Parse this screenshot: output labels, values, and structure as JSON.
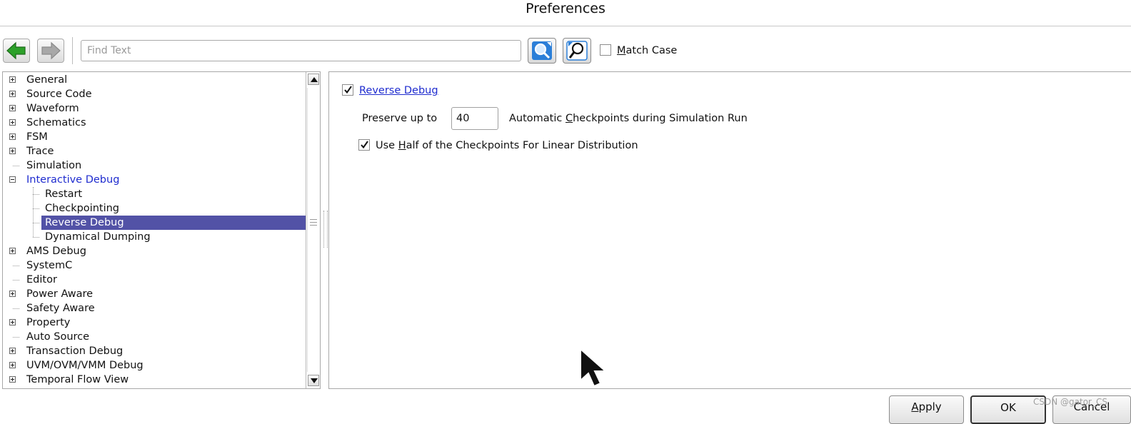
{
  "window": {
    "title": "Preferences"
  },
  "toolbar": {
    "back_icon": "back-arrow-icon",
    "forward_icon": "forward-arrow-icon",
    "find_placeholder": "Find Text",
    "find_value": "",
    "find_next_icon": "find-next-icon",
    "find_prev_icon": "find-previous-icon",
    "match_case_label_pre": "",
    "match_case_accel": "M",
    "match_case_label_post": "atch Case",
    "match_case_checked": false
  },
  "tree": {
    "items": [
      {
        "label": "General",
        "level": 0,
        "expander": "plus"
      },
      {
        "label": "Source Code",
        "level": 0,
        "expander": "plus"
      },
      {
        "label": "Waveform",
        "level": 0,
        "expander": "plus"
      },
      {
        "label": "Schematics",
        "level": 0,
        "expander": "plus"
      },
      {
        "label": "FSM",
        "level": 0,
        "expander": "plus"
      },
      {
        "label": "Trace",
        "level": 0,
        "expander": "plus"
      },
      {
        "label": "Simulation",
        "level": 0,
        "expander": "none"
      },
      {
        "label": "Interactive Debug",
        "level": 0,
        "expander": "minus",
        "state": "active"
      },
      {
        "label": "Restart",
        "level": 1,
        "expander": "none"
      },
      {
        "label": "Checkpointing",
        "level": 1,
        "expander": "none"
      },
      {
        "label": "Reverse Debug",
        "level": 1,
        "expander": "none",
        "state": "selected"
      },
      {
        "label": "Dynamical Dumping",
        "level": 1,
        "expander": "none"
      },
      {
        "label": "AMS Debug",
        "level": 0,
        "expander": "plus"
      },
      {
        "label": "SystemC",
        "level": 0,
        "expander": "none"
      },
      {
        "label": "Editor",
        "level": 0,
        "expander": "none"
      },
      {
        "label": "Power Aware",
        "level": 0,
        "expander": "plus"
      },
      {
        "label": "Safety Aware",
        "level": 0,
        "expander": "none"
      },
      {
        "label": "Property",
        "level": 0,
        "expander": "plus"
      },
      {
        "label": "Auto Source",
        "level": 0,
        "expander": "none"
      },
      {
        "label": "Transaction Debug",
        "level": 0,
        "expander": "plus"
      },
      {
        "label": "UVM/OVM/VMM Debug",
        "level": 0,
        "expander": "plus"
      },
      {
        "label": "Temporal Flow View",
        "level": 0,
        "expander": "plus"
      }
    ]
  },
  "reverse_debug": {
    "enable_label": "Reverse Debug",
    "enable_checked": true,
    "preserve_label": "Preserve up to",
    "preserve_value": "40",
    "checkpoints_pre": "Automatic ",
    "checkpoints_accel": "C",
    "checkpoints_post": "heckpoints during Simulation Run",
    "half_checked": true,
    "half_pre": "Use ",
    "half_accel": "H",
    "half_post": "alf of the Checkpoints For Linear Distribution"
  },
  "buttons": {
    "apply_accel": "A",
    "apply_rest": "pply",
    "ok": "OK",
    "cancel": "Cancel"
  },
  "watermark": "CSDN @gator_CS",
  "colors": {
    "selection": "#5252a6",
    "link": "#1f2ccf",
    "back_arrow": "#2da12a",
    "forward_arrow": "#9b9b9b",
    "search_blue": "#2b7fd8"
  }
}
